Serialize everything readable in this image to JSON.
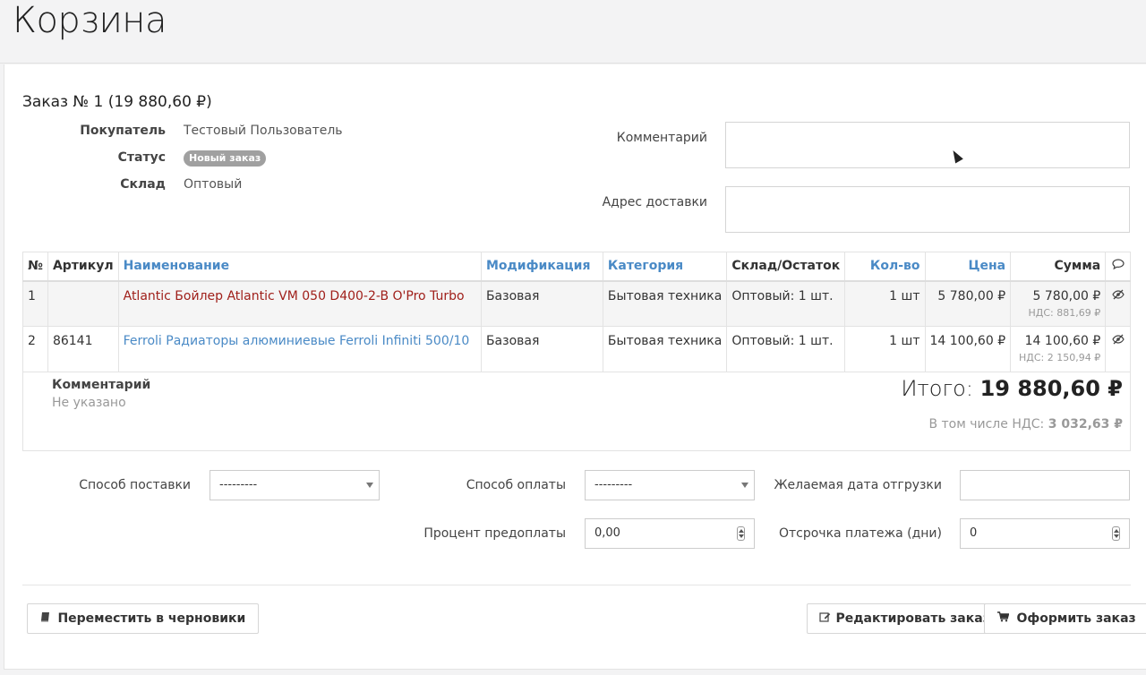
{
  "page": {
    "title": "Корзина"
  },
  "order": {
    "title": "Заказ № 1 (19 880,60 ₽)",
    "buyer_label": "Покупатель",
    "buyer_value": "Тестовый Пользователь",
    "status_label": "Статус",
    "status_value": "Новый заказ",
    "warehouse_label": "Склад",
    "warehouse_value": "Оптовый",
    "comment_label": "Комментарий",
    "address_label": "Адрес доставки"
  },
  "table": {
    "headers": {
      "num": "№",
      "article": "Артикул",
      "name": "Наименование",
      "modification": "Модификация",
      "category": "Категория",
      "stock": "Склад/Остаток",
      "qty": "Кол-во",
      "price": "Цена",
      "sum": "Сумма"
    },
    "rows": [
      {
        "num": "1",
        "article": "",
        "name": "Atlantic Бойлер Atlantic VM 050 D400-2-B O'Pro Turbo",
        "modification": "Базовая",
        "category": "Бытовая техника",
        "stock": "Оптовый: 1 шт.",
        "qty": "1 шт",
        "price": "5 780,00 ₽",
        "sum": "5 780,00 ₽",
        "vat": "НДС: 881,69 ₽"
      },
      {
        "num": "2",
        "article": "86141",
        "name": "Ferroli Радиаторы алюминиевые Ferroli Infiniti 500/10",
        "modification": "Базовая",
        "category": "Бытовая техника",
        "stock": "Оптовый: 1 шт.",
        "qty": "1 шт",
        "price": "14 100,60 ₽",
        "sum": "14 100,60 ₽",
        "vat": "НДС: 2 150,94 ₽"
      }
    ],
    "footer": {
      "comment_label": "Комментарий",
      "comment_value": "Не указано",
      "total_label": "Итого:",
      "total_value": "19 880,60 ₽",
      "vat_label": "В том числе НДС:",
      "vat_value": "3 032,63 ₽"
    }
  },
  "form": {
    "delivery_label": "Способ поставки",
    "delivery_value": "---------",
    "payment_label": "Способ оплаты",
    "payment_value": "---------",
    "ship_date_label": "Желаемая дата отгрузки",
    "ship_date_value": "",
    "prepay_label": "Процент предоплаты",
    "prepay_value": "0,00",
    "deferral_label": "Отсрочка платежа (дни)",
    "deferral_value": "0"
  },
  "actions": {
    "move_to_drafts": "Переместить в черновики",
    "edit_order": "Редактировать заказ",
    "place_order": "Оформить заказ"
  },
  "colors": {
    "link": "#4a8ac6",
    "product_red": "#a0201b",
    "badge": "#a0a0a0"
  },
  "icons": [
    "comment-icon",
    "eye-slash-icon",
    "book-icon",
    "edit-icon",
    "cart-icon"
  ]
}
